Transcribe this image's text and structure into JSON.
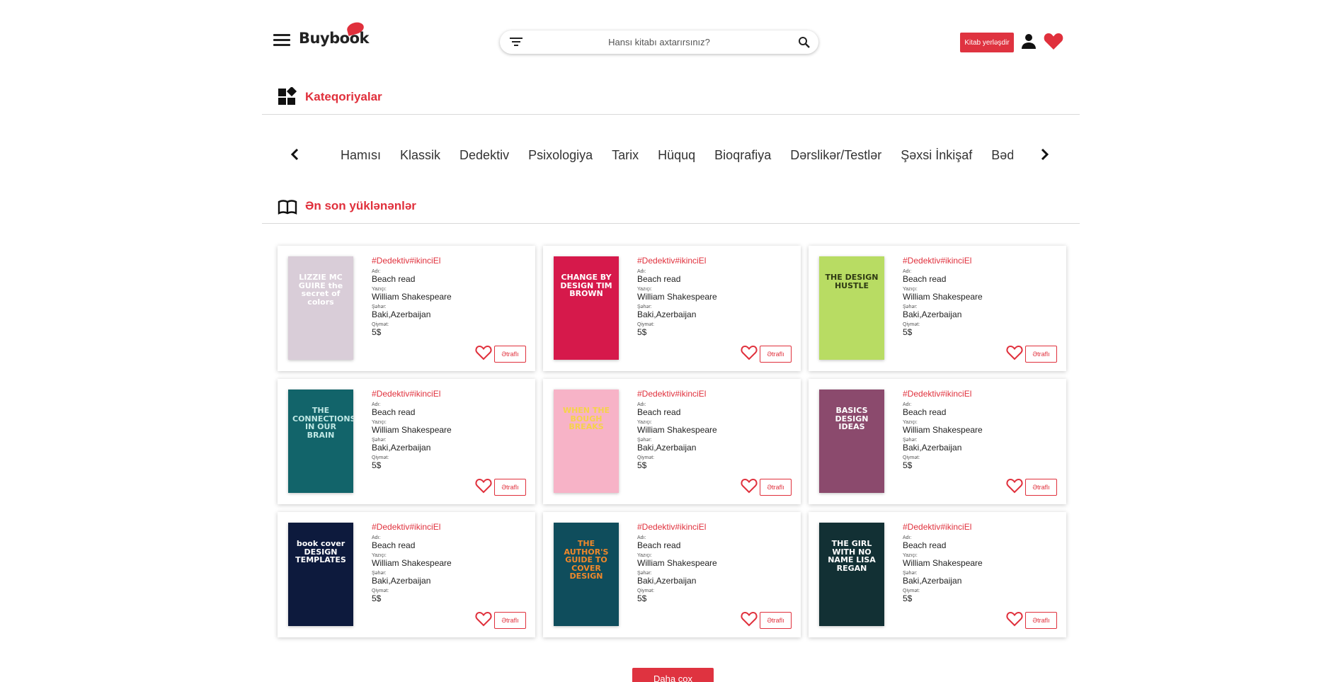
{
  "header": {
    "logo": "Buybook",
    "search_placeholder": "Hansı kitabı axtarırsınız?",
    "publish_label": "Kitab yerləşdir"
  },
  "categories_section": {
    "title": "Kateqoriyalar",
    "items": [
      "Hamısı",
      "Klassik",
      "Dedektiv",
      "Psixologiya",
      "Tarix",
      "Hüquq",
      "Bioqrafiya",
      "Dərslikər/Testlər",
      "Şəxsi İnkişaf",
      "Bədii"
    ]
  },
  "latest_section": {
    "title": "Ən son yüklənənlər"
  },
  "labels": {
    "name": "Adı:",
    "author": "Yazıçı:",
    "city": "Şəhər:",
    "price": "Qiymət:",
    "more": "Ətraflı"
  },
  "books": [
    {
      "tag": "#Dedektiv#ikinciEl",
      "name": "Beach read",
      "author": "William Shakespeare",
      "city": "Baki,Azerbaijan",
      "price": "5$",
      "cover": {
        "bg": "#d9cdd8",
        "fg": "#ffffff",
        "text": "LIZZIE MC GUIRE the secret of colors"
      }
    },
    {
      "tag": "#Dedektiv#ikinciEl",
      "name": "Beach read",
      "author": "William Shakespeare",
      "city": "Baki,Azerbaijan",
      "price": "5$",
      "cover": {
        "bg": "#d6194b",
        "fg": "#ffffff",
        "text": "CHANGE BY DESIGN TIM BROWN"
      }
    },
    {
      "tag": "#Dedektiv#ikinciEl",
      "name": "Beach read",
      "author": "William Shakespeare",
      "city": "Baki,Azerbaijan",
      "price": "5$",
      "cover": {
        "bg": "#b8dc63",
        "fg": "#2f3a14",
        "text": "THE DESIGN HUSTLE"
      }
    },
    {
      "tag": "#Dedektiv#ikinciEl",
      "name": "Beach read",
      "author": "William Shakespeare",
      "city": "Baki,Azerbaijan",
      "price": "5$",
      "cover": {
        "bg": "#12646a",
        "fg": "#bfe7e4",
        "text": "THE CONNECTIONS IN OUR BRAIN"
      }
    },
    {
      "tag": "#Dedektiv#ikinciEl",
      "name": "Beach read",
      "author": "William Shakespeare",
      "city": "Baki,Azerbaijan",
      "price": "5$",
      "cover": {
        "bg": "#f7b3c7",
        "fg": "#f6d24a",
        "text": "WHEN THE BOUGH BREAKS"
      }
    },
    {
      "tag": "#Dedektiv#ikinciEl",
      "name": "Beach read",
      "author": "William Shakespeare",
      "city": "Baki,Azerbaijan",
      "price": "5$",
      "cover": {
        "bg": "#8b4a6d",
        "fg": "#ffffff",
        "text": "BASICS DESIGN IDEAS"
      }
    },
    {
      "tag": "#Dedektiv#ikinciEl",
      "name": "Beach read",
      "author": "William Shakespeare",
      "city": "Baki,Azerbaijan",
      "price": "5$",
      "cover": {
        "bg": "#0d1a3d",
        "fg": "#ffffff",
        "text": "book cover DESIGN TEMPLATES"
      }
    },
    {
      "tag": "#Dedektiv#ikinciEl",
      "name": "Beach read",
      "author": "William Shakespeare",
      "city": "Baki,Azerbaijan",
      "price": "5$",
      "cover": {
        "bg": "#0f4d5c",
        "fg": "#f0882a",
        "text": "THE AUTHOR'S GUIDE TO COVER DESIGN"
      }
    },
    {
      "tag": "#Dedektiv#ikinciEl",
      "name": "Beach read",
      "author": "William Shakespeare",
      "city": "Baki,Azerbaijan",
      "price": "5$",
      "cover": {
        "bg": "#123034",
        "fg": "#ffffff",
        "text": "THE GIRL WITH NO NAME LISA REGAN"
      }
    }
  ],
  "load_more_label": "Daha çox",
  "colors": {
    "accent": "#e0303c"
  }
}
